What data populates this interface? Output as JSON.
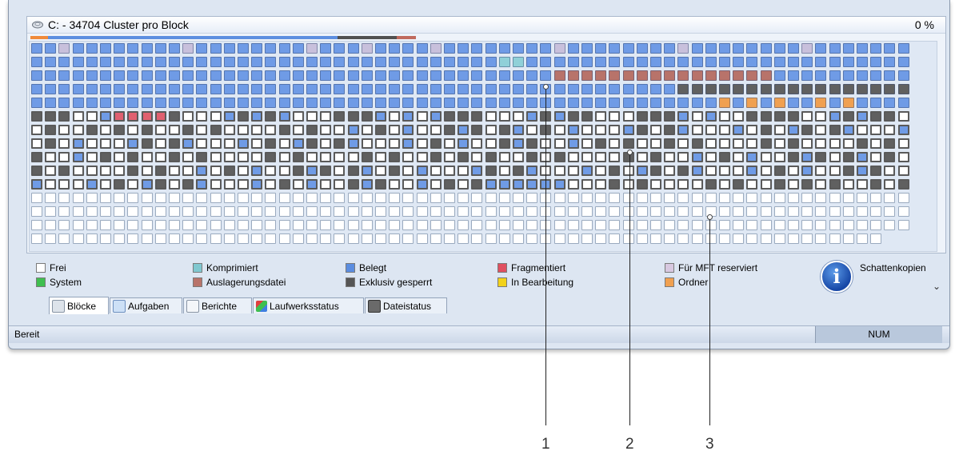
{
  "drive": {
    "title": "C: - 34704 Cluster pro Block",
    "percent": "0 %"
  },
  "legend": {
    "items": [
      {
        "label": "Frei",
        "color": "#ffffff"
      },
      {
        "label": "System",
        "color": "#3fbf4f"
      },
      {
        "label": "Komprimiert",
        "color": "#80c8d0"
      },
      {
        "label": "Auslagerungsdatei",
        "color": "#b8736a"
      },
      {
        "label": "Belegt",
        "color": "#5b8de0"
      },
      {
        "label": "Exklusiv gesperrt",
        "color": "#555555"
      },
      {
        "label": "Fragmentiert",
        "color": "#e05060"
      },
      {
        "label": "In Bearbeitung",
        "color": "#f2d21a"
      },
      {
        "label": "Für MFT reserviert",
        "color": "#d8c8e0"
      },
      {
        "label": "Ordner",
        "color": "#f0a050"
      }
    ],
    "shadow_copies": "Schattenkopien"
  },
  "tabs": [
    {
      "label": "Blöcke",
      "icon": "blocks-icon"
    },
    {
      "label": "Aufgaben",
      "icon": "tasks-icon"
    },
    {
      "label": "Berichte",
      "icon": "reports-icon"
    },
    {
      "label": "Laufwerksstatus",
      "icon": "drive-status-icon"
    },
    {
      "label": "Dateistatus",
      "icon": "file-status-icon"
    }
  ],
  "status": {
    "text": "Bereit",
    "num": "NUM"
  },
  "callouts": [
    "1",
    "2",
    "3"
  ],
  "block_colors": {
    "used": "#6f9be6",
    "locked": "#606060",
    "free": "#ffffff",
    "mft": "#c8c0dc",
    "paging": "#b8736a",
    "fragmented": "#e06070",
    "folder": "#f0a050",
    "compressed": "#90d0d8",
    "outline": "#5a5a5a"
  }
}
